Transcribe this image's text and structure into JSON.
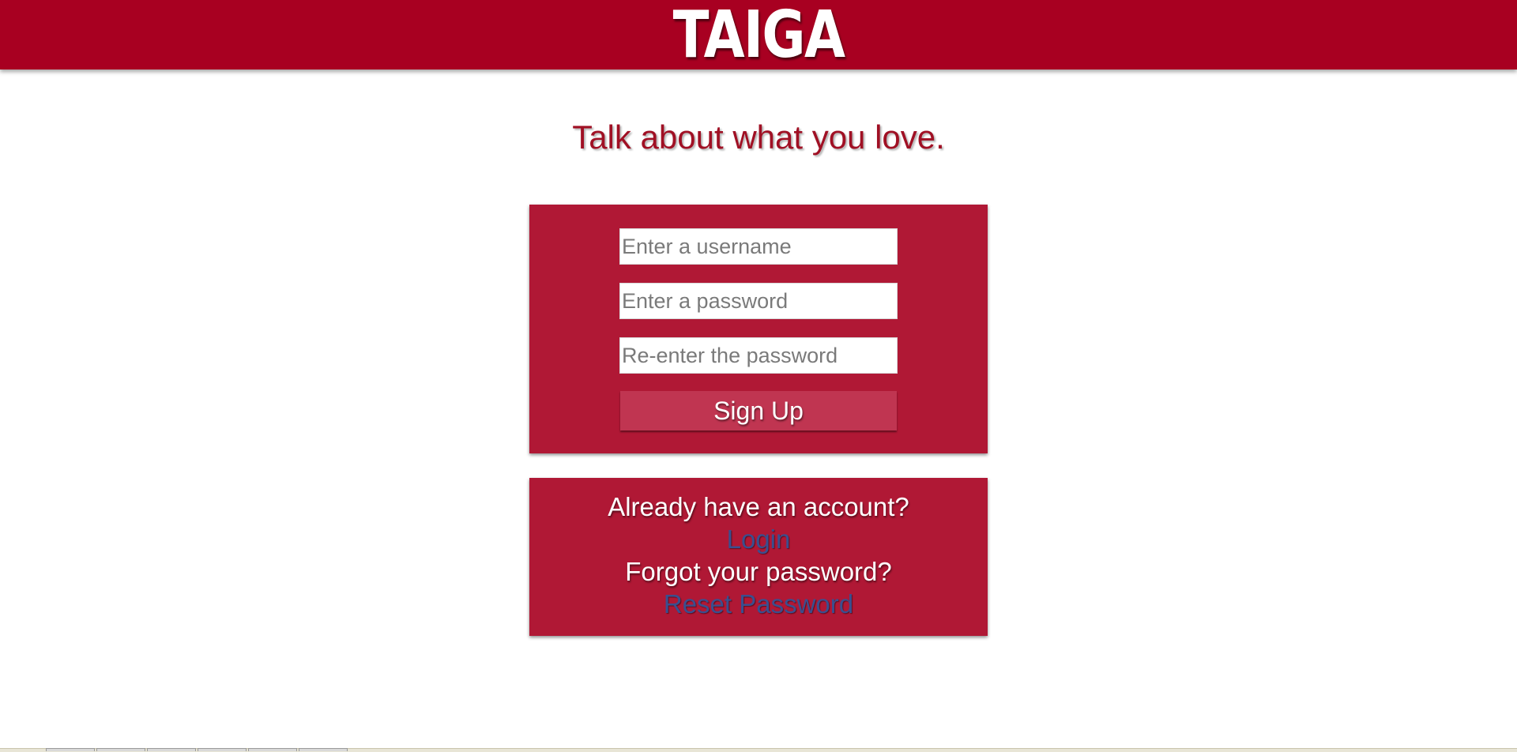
{
  "header": {
    "logo_text": "TAIGA",
    "background_color": "#a80021"
  },
  "tagline": "Talk about what you love.",
  "signup_form": {
    "username_placeholder": "Enter a username",
    "password_placeholder": "Enter a password",
    "confirm_placeholder": "Re-enter the password",
    "submit_label": "Sign Up",
    "card_color": "#b01835"
  },
  "account_links": {
    "have_account_text": "Already have an account?",
    "login_label": "Login",
    "forgot_text": "Forgot your password?",
    "reset_label": "Reset Password",
    "link_color": "#3a4f8f"
  }
}
